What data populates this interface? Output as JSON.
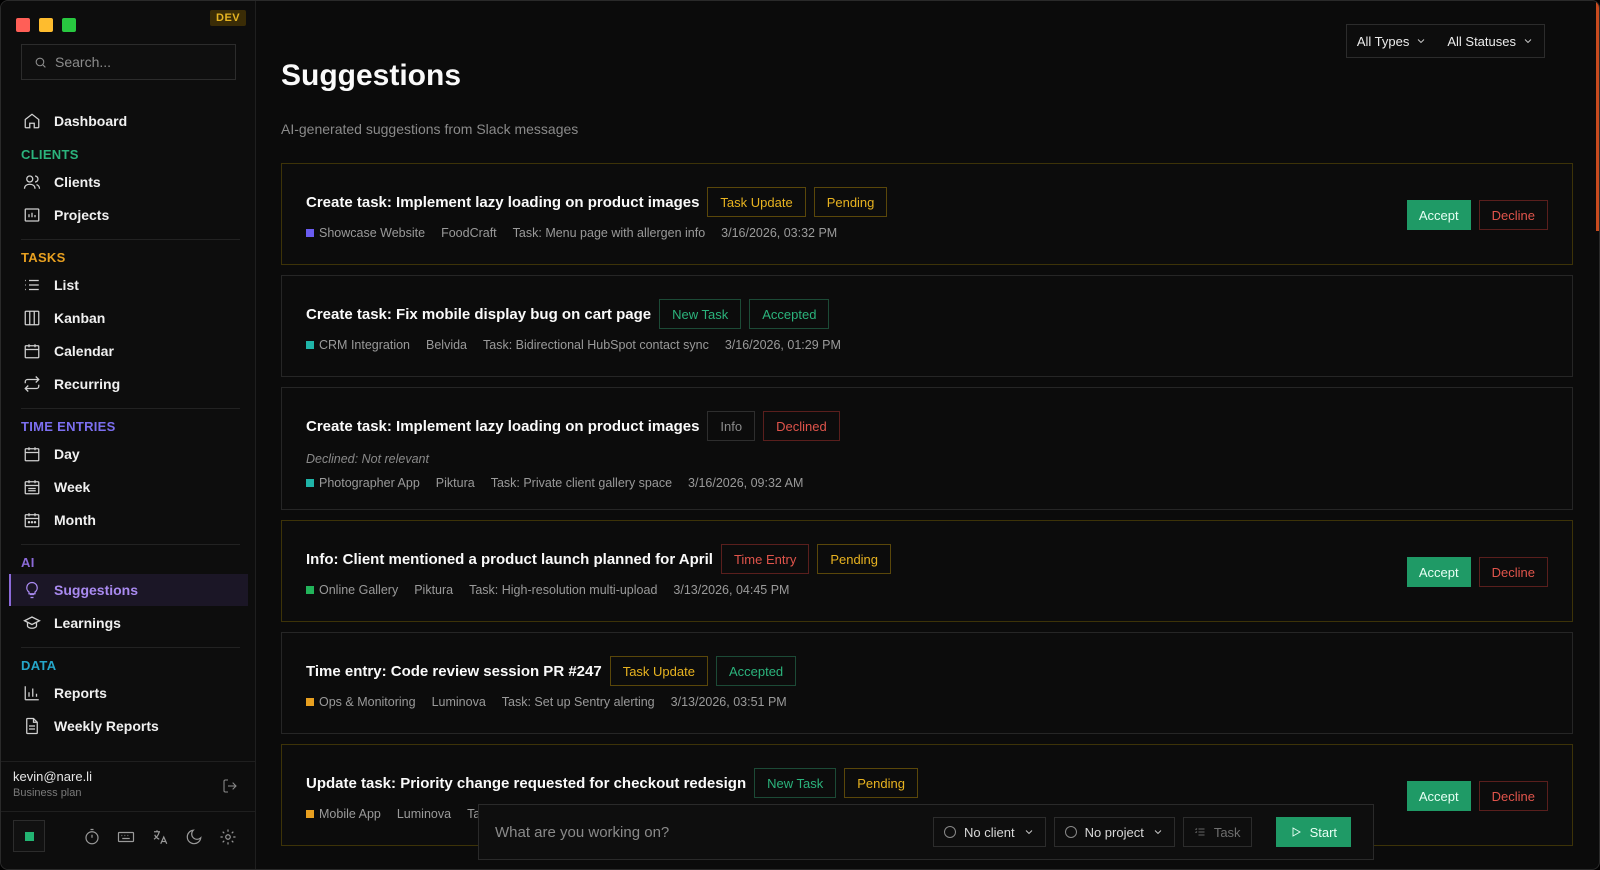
{
  "app": {
    "env_badge": "DEV"
  },
  "colors": {
    "accent_green": "#1f9a66",
    "accent_purple": "#a98af0",
    "pending_yellow": "#e8b320",
    "danger_red": "#e0544b"
  },
  "sidebar": {
    "search_placeholder": "Search...",
    "dashboard": "Dashboard",
    "sections": {
      "clients": {
        "label": "CLIENTS",
        "color": "#2bb37c",
        "items": [
          "Clients",
          "Projects"
        ]
      },
      "tasks": {
        "label": "TASKS",
        "color": "#e8a020",
        "items": [
          "List",
          "Kanban",
          "Calendar",
          "Recurring"
        ]
      },
      "time": {
        "label": "TIME ENTRIES",
        "color": "#7c6ff0",
        "items": [
          "Day",
          "Week",
          "Month"
        ]
      },
      "ai": {
        "label": "AI",
        "color": "#8b6ad8",
        "items": [
          "Suggestions",
          "Learnings"
        ]
      },
      "data": {
        "label": "DATA",
        "color": "#25a6c9",
        "items": [
          "Reports",
          "Weekly Reports"
        ]
      }
    },
    "active_item": "Suggestions",
    "user": {
      "email": "kevin@nare.li",
      "plan": "Business plan"
    }
  },
  "header": {
    "title": "Suggestions",
    "subtitle": "AI-generated suggestions from Slack messages",
    "filter_type": "All Types",
    "filter_status": "All Statuses"
  },
  "actions": {
    "accept": "Accept",
    "decline": "Decline"
  },
  "suggestions": [
    {
      "title": "Create task: Implement lazy loading on product images",
      "type": "Task Update",
      "status": "Pending",
      "project": "Showcase Website",
      "project_color": "#6a5cf0",
      "client": "FoodCraft",
      "task": "Task: Menu page with allergen info",
      "time": "3/16/2026, 03:32 PM"
    },
    {
      "title": "Create task: Fix mobile display bug on cart page",
      "type": "New Task",
      "status": "Accepted",
      "project": "CRM Integration",
      "project_color": "#1fb4a8",
      "client": "Belvida",
      "task": "Task: Bidirectional HubSpot contact sync",
      "time": "3/16/2026, 01:29 PM"
    },
    {
      "title": "Create task: Implement lazy loading on product images",
      "type": "Info",
      "status": "Declined",
      "note": "Declined: Not relevant",
      "project": "Photographer App",
      "project_color": "#1fb4a8",
      "client": "Piktura",
      "task": "Task: Private client gallery space",
      "time": "3/16/2026, 09:32 AM"
    },
    {
      "title": "Info: Client mentioned a product launch planned for April",
      "type": "Time Entry",
      "status": "Pending",
      "project": "Online Gallery",
      "project_color": "#22b45a",
      "client": "Piktura",
      "task": "Task: High-resolution multi-upload",
      "time": "3/13/2026, 04:45 PM"
    },
    {
      "title": "Time entry: Code review session PR #247",
      "type": "Task Update",
      "status": "Accepted",
      "project": "Ops & Monitoring",
      "project_color": "#e8a020",
      "client": "Luminova",
      "task": "Task: Set up Sentry alerting",
      "time": "3/13/2026, 03:51 PM"
    },
    {
      "title": "Update task: Priority change requested for checkout redesign",
      "type": "New Task",
      "status": "Pending",
      "project": "Mobile App",
      "project_color": "#e8a020",
      "client": "Luminova",
      "task": "Ta",
      "time": ""
    }
  ],
  "timer": {
    "placeholder": "What are you working on?",
    "client": "No client",
    "project": "No project",
    "task": "Task",
    "start": "Start"
  }
}
